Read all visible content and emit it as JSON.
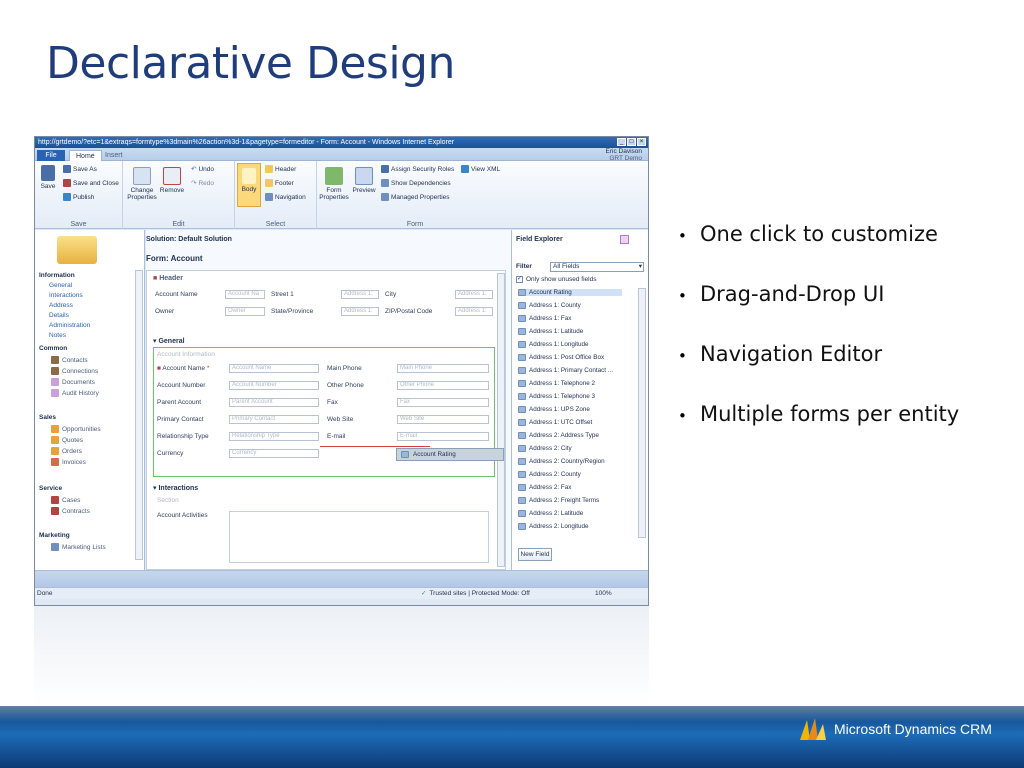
{
  "slide": {
    "title": "Declarative Design",
    "bullets": [
      "One click to customize",
      "Drag-and-Drop UI",
      "Navigation Editor",
      "Multiple forms per entity"
    ],
    "brand": "Microsoft Dynamics CRM"
  },
  "window": {
    "title": "http://grtdemo/?etc=1&extraqs=formtype%3dmain%26action%3d-1&pagetype=formeditor - Form: Account - Windows Internet Explorer",
    "user_name": "Eric Davison",
    "user_org": "GRT Demo",
    "tabs": [
      "File",
      "Home",
      "Insert"
    ]
  },
  "ribbon": {
    "save": "Save",
    "save_as": "Save As",
    "save_close": "Save and Close",
    "publish": "Publish",
    "change_properties": "Change Properties",
    "remove": "Remove",
    "undo": "Undo",
    "redo": "Redo",
    "body": "Body",
    "header": "Header",
    "footer": "Footer",
    "navigation": "Navigation",
    "form_properties": "Form Properties",
    "preview": "Preview",
    "assign_security_roles": "Assign Security Roles",
    "view_xml": "View XML",
    "show_dependencies": "Show Dependencies",
    "managed_properties": "Managed Properties",
    "groups": {
      "save": "Save",
      "edit": "Edit",
      "select": "Select",
      "form": "Form"
    }
  },
  "nav": {
    "information": "Information",
    "info_items": [
      "General",
      "Interactions",
      "Address",
      "Details",
      "Administration",
      "Notes"
    ],
    "common": "Common",
    "common_items": [
      "Contacts",
      "Connections",
      "Documents",
      "Audit History"
    ],
    "sales": "Sales",
    "sales_items": [
      "Opportunities",
      "Quotes",
      "Orders",
      "Invoices"
    ],
    "service": "Service",
    "service_items": [
      "Cases",
      "Contracts"
    ],
    "marketing": "Marketing",
    "marketing_items": [
      "Marketing Lists"
    ]
  },
  "form": {
    "solution": "Solution: Default Solution",
    "form_name": "Form: Account",
    "header_label": "Header",
    "header_fields": [
      {
        "label": "Account Name",
        "value": "Account Na"
      },
      {
        "label": "Street 1",
        "value": "Address 1:"
      },
      {
        "label": "City",
        "value": "Address 1:"
      },
      {
        "label": "Owner",
        "value": "Owner"
      },
      {
        "label": "State/Province",
        "value": "Address 1:"
      },
      {
        "label": "ZIP/Postal Code",
        "value": "Address 1:"
      }
    ],
    "general_label": "General",
    "account_info": "Account Information",
    "left_fields": [
      {
        "label": "Account Name",
        "value": "Account Name"
      },
      {
        "label": "Account Number",
        "value": "Account Number"
      },
      {
        "label": "Parent Account",
        "value": "Parent Account"
      },
      {
        "label": "Primary Contact",
        "value": "Primary Contact"
      },
      {
        "label": "Relationship Type",
        "value": "Relationship Type"
      },
      {
        "label": "Currency",
        "value": "Currency"
      }
    ],
    "right_fields": [
      {
        "label": "Main Phone",
        "value": "Main Phone"
      },
      {
        "label": "Other Phone",
        "value": "Other Phone"
      },
      {
        "label": "Fax",
        "value": "Fax"
      },
      {
        "label": "Web Site",
        "value": "Web Site"
      },
      {
        "label": "E-mail",
        "value": "E-mail"
      }
    ],
    "interactions_label": "Interactions",
    "section_label": "Section",
    "account_activities": "Account Activities",
    "dragging": "Account Rating"
  },
  "field_explorer": {
    "title": "Field Explorer",
    "filter_label": "Filter",
    "filter_value": "All Fields",
    "only_unused": "Only show unused fields",
    "fields": [
      "Account Rating",
      "Address 1: County",
      "Address 1: Fax",
      "Address 1: Latitude",
      "Address 1: Longitude",
      "Address 1: Post Office Box",
      "Address 1: Primary Contact ...",
      "Address 1: Telephone 2",
      "Address 1: Telephone 3",
      "Address 1: UPS Zone",
      "Address 1: UTC Offset",
      "Address 2: Address Type",
      "Address 2: City",
      "Address 2: Country/Region",
      "Address 2: County",
      "Address 2: Fax",
      "Address 2: Freight Terms",
      "Address 2: Latitude",
      "Address 2: Longitude"
    ],
    "new_field": "New Field"
  },
  "status": {
    "left": "Done",
    "zone": "Trusted sites | Protected Mode: Off",
    "zoom": "100%"
  }
}
